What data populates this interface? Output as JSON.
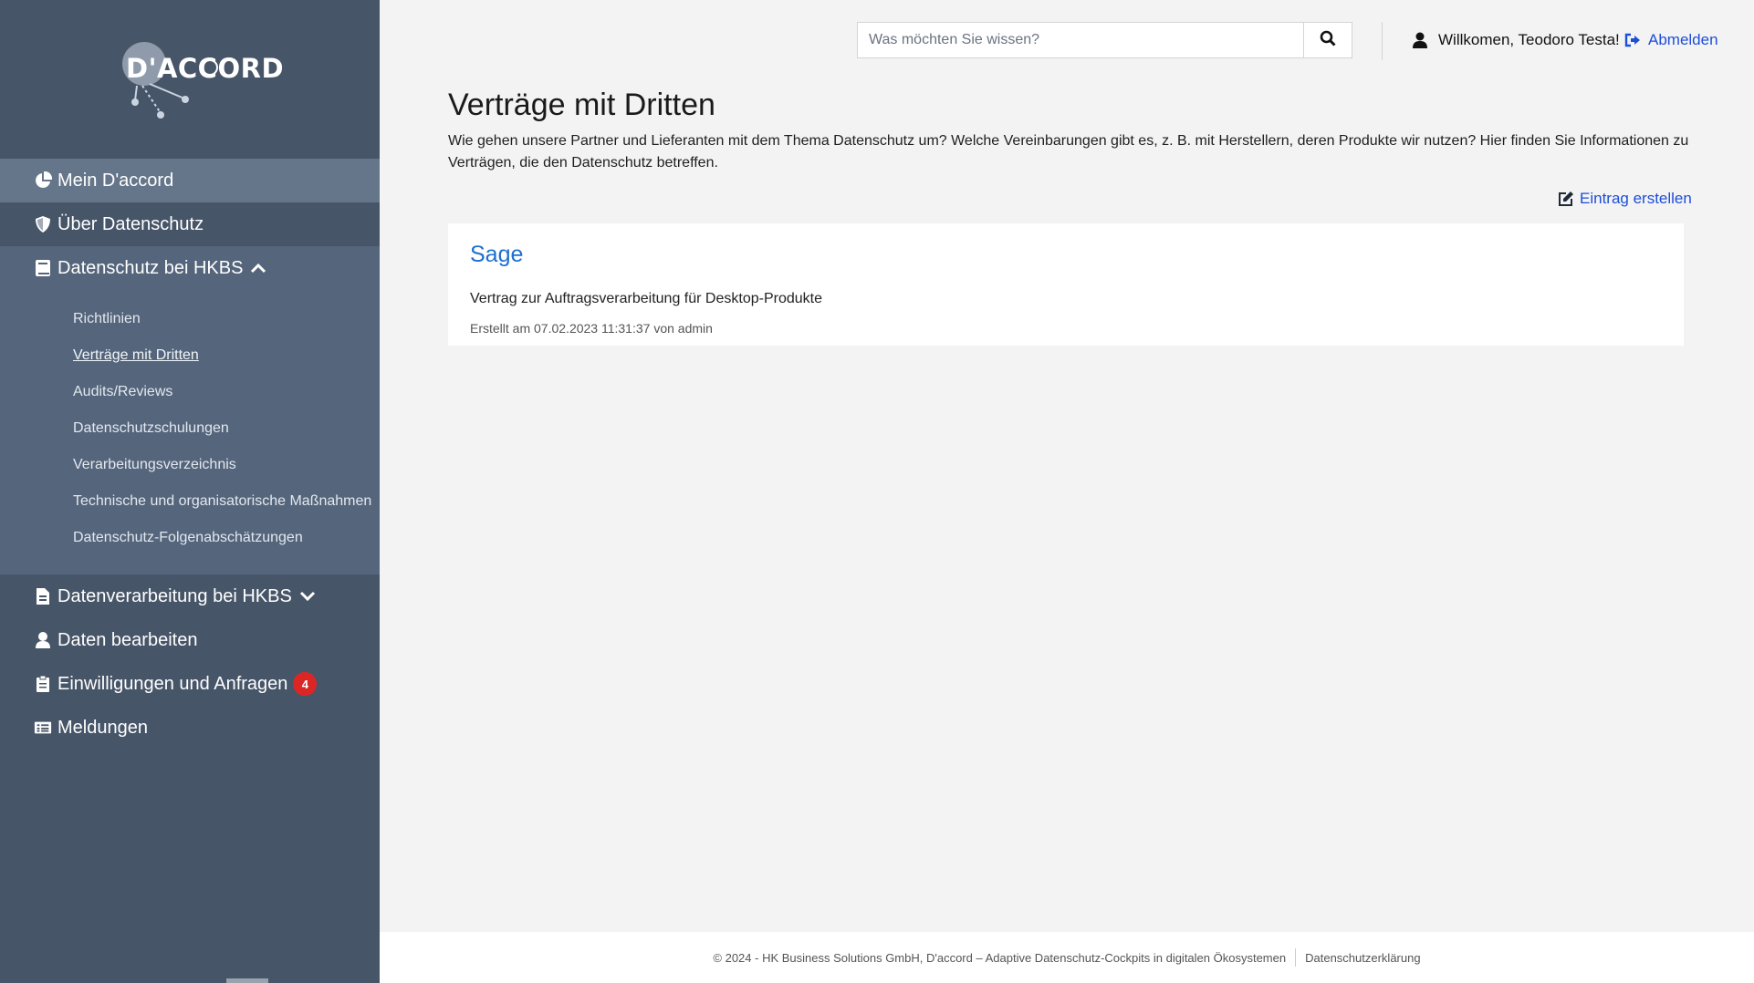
{
  "logo": {
    "text": "D'ACCORD"
  },
  "sidebar": {
    "items": [
      {
        "label": "Mein D'accord",
        "icon": "pie-chart-icon"
      },
      {
        "label": "Über Datenschutz",
        "icon": "shield-icon"
      },
      {
        "label": "Datenschutz bei HKBS",
        "icon": "book-icon"
      },
      {
        "label": "Datenverarbeitung bei HKBS",
        "icon": "file-icon"
      },
      {
        "label": "Daten bearbeiten",
        "icon": "user-icon"
      },
      {
        "label": "Einwilligungen und Anfragen",
        "icon": "clipboard-icon",
        "badge": "4"
      },
      {
        "label": "Meldungen",
        "icon": "list-icon"
      }
    ],
    "submenu": [
      "Richtlinien",
      "Verträge mit Dritten",
      "Audits/Reviews",
      "Datenschutzschulungen",
      "Verarbeitungsverzeichnis",
      "Technische und organisatorische Maßnahmen",
      "Datenschutz-Folgenabschätzungen"
    ]
  },
  "header": {
    "search_placeholder": "Was möchten Sie wissen?",
    "welcome": "Willkomen, Teodoro Testa!",
    "logout": "Abmelden"
  },
  "main": {
    "title": "Verträge mit Dritten",
    "description": "Wie gehen unsere Partner und Lieferanten mit dem Thema Datenschutz um? Welche Vereinbarungen gibt es, z. B. mit Herstellern, deren Produkte wir nutzen? Hier finden Sie Informationen zu Verträgen, die den Datenschutz betreffen.",
    "create_label": "Eintrag erstellen",
    "entries": [
      {
        "title": "Sage",
        "subtitle": "Vertrag zur Auftragsverarbeitung für Desktop-Produkte",
        "meta": "Erstellt am 07.02.2023 11:31:37 von admin"
      }
    ]
  },
  "footer": {
    "copyright": "© 2024 - HK Business Solutions GmbH, D'accord – Adaptive Datenschutz-Cockpits in digitalen Ökosystemen",
    "privacy_link": "Datenschutzerklärung"
  },
  "colors": {
    "sidebar_bg": "#475569",
    "active_item_bg": "#65758a",
    "accent_link": "#1d4ed8",
    "badge": "#dc2626"
  }
}
